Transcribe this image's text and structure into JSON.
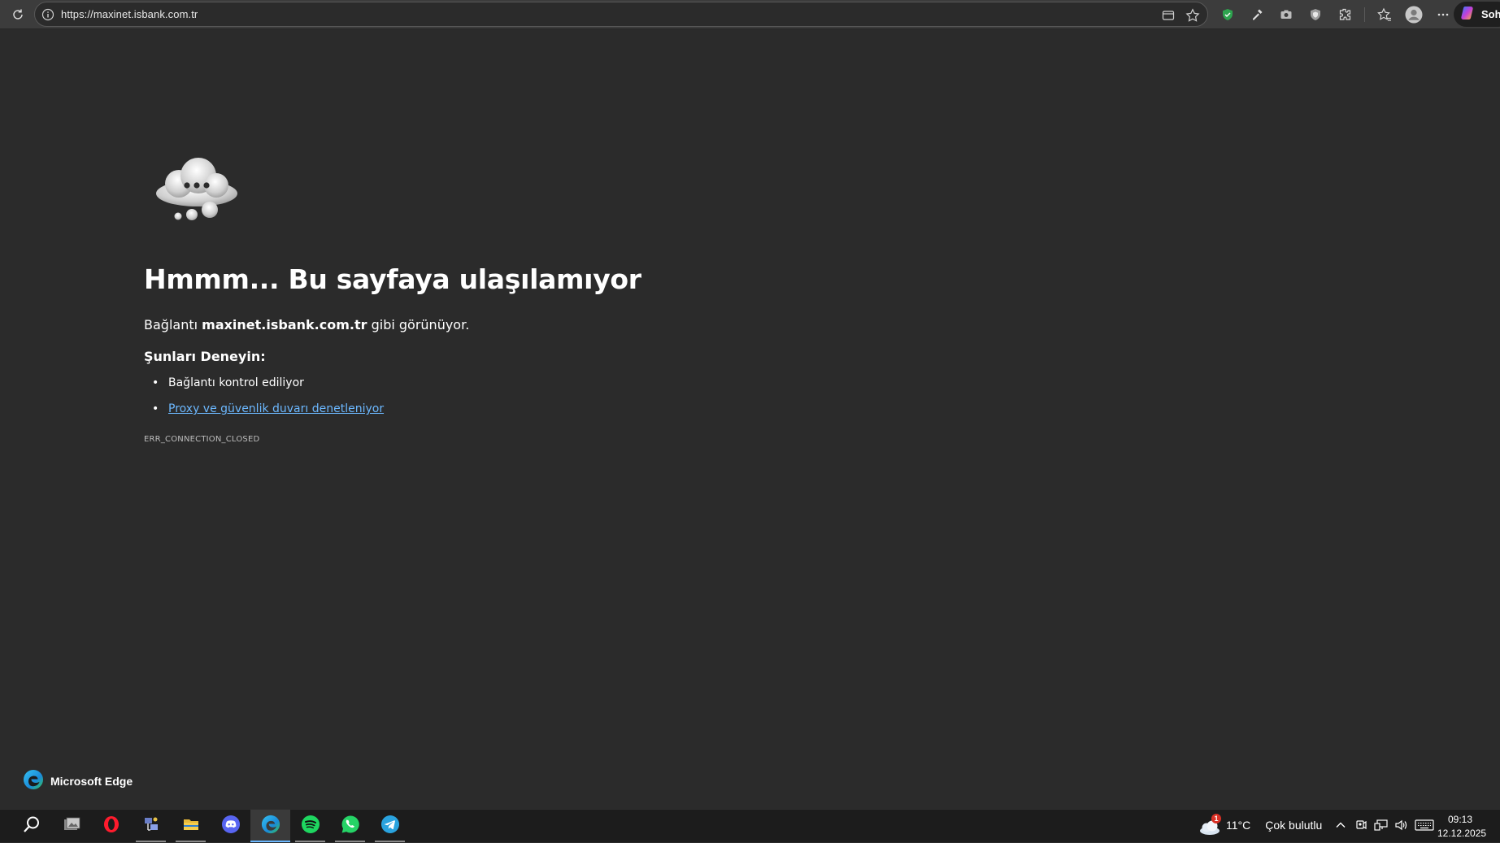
{
  "browser": {
    "url": "https://maxinet.isbank.com.tr",
    "copilot_label": "Sohb",
    "toolbar_icons": [
      "read-view-icon",
      "favorite-star-icon",
      "shield-extension-icon",
      "eyedropper-icon",
      "camera-icon",
      "privacy-badger-icon",
      "extensions-icon",
      "favorites-icon",
      "profile-icon",
      "more-menu-icon"
    ]
  },
  "page": {
    "title": "Hmmm... Bu sayfaya ulaşılamıyor",
    "desc_before": "Bağlantı ",
    "desc_host": "maxinet.isbank.com.tr",
    "desc_after": " gibi görünüyor.",
    "try_title": "Şunları Deneyin:",
    "suggestions": [
      {
        "text": "Bağlantı kontrol ediliyor",
        "link": false
      },
      {
        "text": "Proxy ve güvenlik duvarı denetleniyor",
        "link": true
      }
    ],
    "error_code": "ERR_CONNECTION_CLOSED",
    "brand": "Microsoft Edge"
  },
  "taskbar": {
    "apps": [
      "search",
      "file-explorer-alt",
      "opera",
      "network-tool",
      "file-explorer",
      "discord",
      "edge",
      "spotify",
      "whatsapp",
      "telegram"
    ],
    "active_app": "edge",
    "weather_temp": "11°C",
    "weather_text": "Çok bulutlu",
    "weather_badge": "1",
    "time": "09:13",
    "date": "12.12.2025"
  },
  "colors": {
    "background": "#2b2b2b",
    "link": "#6cb8ff",
    "taskbar": "#1c1c1c"
  }
}
